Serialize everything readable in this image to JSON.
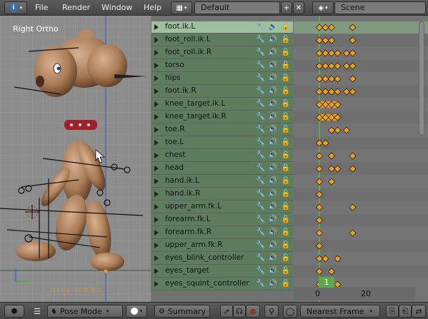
{
  "topbar": {
    "info_icon": "info-icon",
    "menus": [
      "File",
      "Render",
      "Window",
      "Help"
    ],
    "layout": "Default",
    "scene": "Scene"
  },
  "viewport": {
    "view_label": "Right Ortho",
    "status_text": "(1) rig : foot.ik.L"
  },
  "channels": [
    {
      "name": "foot.ik.L",
      "selected": true
    },
    {
      "name": "foot_roll.ik.L",
      "selected": false
    },
    {
      "name": "foot_roll.ik.R",
      "selected": false
    },
    {
      "name": "torso",
      "selected": false
    },
    {
      "name": "hips",
      "selected": false
    },
    {
      "name": "foot.ik.R",
      "selected": false
    },
    {
      "name": "knee_target.ik.L",
      "selected": false
    },
    {
      "name": "knee_target.ik.R",
      "selected": false
    },
    {
      "name": "toe.R",
      "selected": false
    },
    {
      "name": "toe.L",
      "selected": false
    },
    {
      "name": "chest",
      "selected": false
    },
    {
      "name": "head",
      "selected": false
    },
    {
      "name": "hand.ik.L",
      "selected": false
    },
    {
      "name": "hand.ik.R",
      "selected": false
    },
    {
      "name": "upper_arm.fk.L",
      "selected": false
    },
    {
      "name": "forearm.fk.L",
      "selected": false
    },
    {
      "name": "forearm.fk.R",
      "selected": false
    },
    {
      "name": "upper_arm.fk.R",
      "selected": false
    },
    {
      "name": "eyes_blink_controller",
      "selected": false
    },
    {
      "name": "eyes_target",
      "selected": false
    },
    {
      "name": "eyes_squint_controller",
      "selected": false
    }
  ],
  "keyframes": [
    [
      0,
      1,
      2,
      5
    ],
    [
      0,
      1,
      2,
      5
    ],
    [
      0,
      1,
      2,
      3,
      4,
      5
    ],
    [
      0,
      1,
      2,
      3,
      4,
      5
    ],
    [
      0,
      1,
      2,
      3,
      5
    ],
    [
      0,
      1,
      2,
      3,
      4,
      5
    ],
    [
      0,
      1,
      2,
      3
    ],
    [
      0,
      1,
      2,
      3
    ],
    [
      2,
      3,
      4
    ],
    [
      0,
      1
    ],
    [
      0,
      2,
      5
    ],
    [
      0,
      2,
      3,
      5
    ],
    [
      0,
      2
    ],
    [
      0
    ],
    [
      0,
      5
    ],
    [
      0
    ],
    [
      0,
      5
    ],
    [
      0
    ],
    [
      0,
      1,
      3
    ],
    [
      0,
      2
    ],
    [
      0,
      3
    ]
  ],
  "hold_rows": [
    6,
    7
  ],
  "timeline": {
    "current_frame": "1",
    "tick_0": "0",
    "tick_20": "20"
  },
  "bottombar": {
    "mode": "Pose Mode",
    "summary": "Summary",
    "snap": "Nearest Frame"
  },
  "colors": {
    "keyframe": "#f0a020",
    "selected_channel": "#9ec09e",
    "channel": "#5e7d5e",
    "playhead": "#5fa84d"
  }
}
